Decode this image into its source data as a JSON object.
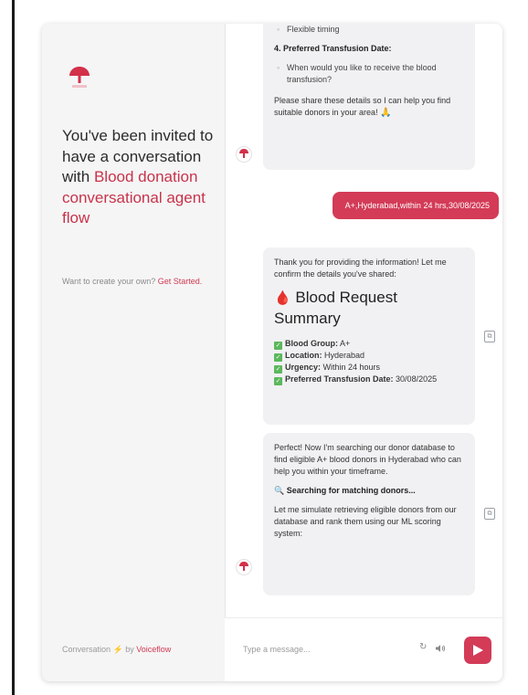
{
  "left_panel": {
    "invite_prefix": "You've been invited to have a conversation with ",
    "invite_flow_name": "Blood donation conversational agent flow",
    "want_text": "Want to create your own? ",
    "get_started_label": "Get Started.",
    "footer_prefix": "Conversation",
    "footer_by": " by ",
    "footer_brand": "Voiceflow"
  },
  "messages": {
    "bot1": {
      "item_prev": "Flexible timing",
      "heading4": "4. Preferred Transfusion Date:",
      "item4": "When would you like to receive the blood transfusion?",
      "closing": "Please share these details so I can help you find suitable donors in your area!",
      "emoji": "🙏"
    },
    "user1": "A+,Hyderabad,within 24 hrs,30/08/2025",
    "bot2": {
      "intro": "Thank you for providing the information! Let me confirm the details you've shared:",
      "summary_title": "Blood Request Summary",
      "fields": [
        {
          "label": "Blood Group:",
          "value": " A+"
        },
        {
          "label": "Location:",
          "value": " Hyderabad"
        },
        {
          "label": "Urgency:",
          "value": " Within 24 hours"
        },
        {
          "label": "Preferred Transfusion Date:",
          "value": " 30/08/2025"
        }
      ]
    },
    "bot3": {
      "intro": "Perfect! Now I'm searching our donor database to find eligible A+ blood donors in Hyderabad who can help you within your timeframe.",
      "searching": "Searching for matching donors...",
      "simulate": "Let me simulate retrieving eligible donors from our database and rank them using our ML scoring system:"
    }
  },
  "composer": {
    "placeholder": "Type a message..."
  },
  "colors": {
    "accent": "#d33b57",
    "bubble": "#f1f1f3",
    "panel": "#f5f5f6"
  },
  "icons": [
    "logo-icon",
    "bot-avatar-icon",
    "copy-icon",
    "refresh-icon",
    "speaker-icon",
    "send-icon",
    "blood-drop-icon",
    "check-icon",
    "magnifier-icon",
    "lightning-icon"
  ]
}
